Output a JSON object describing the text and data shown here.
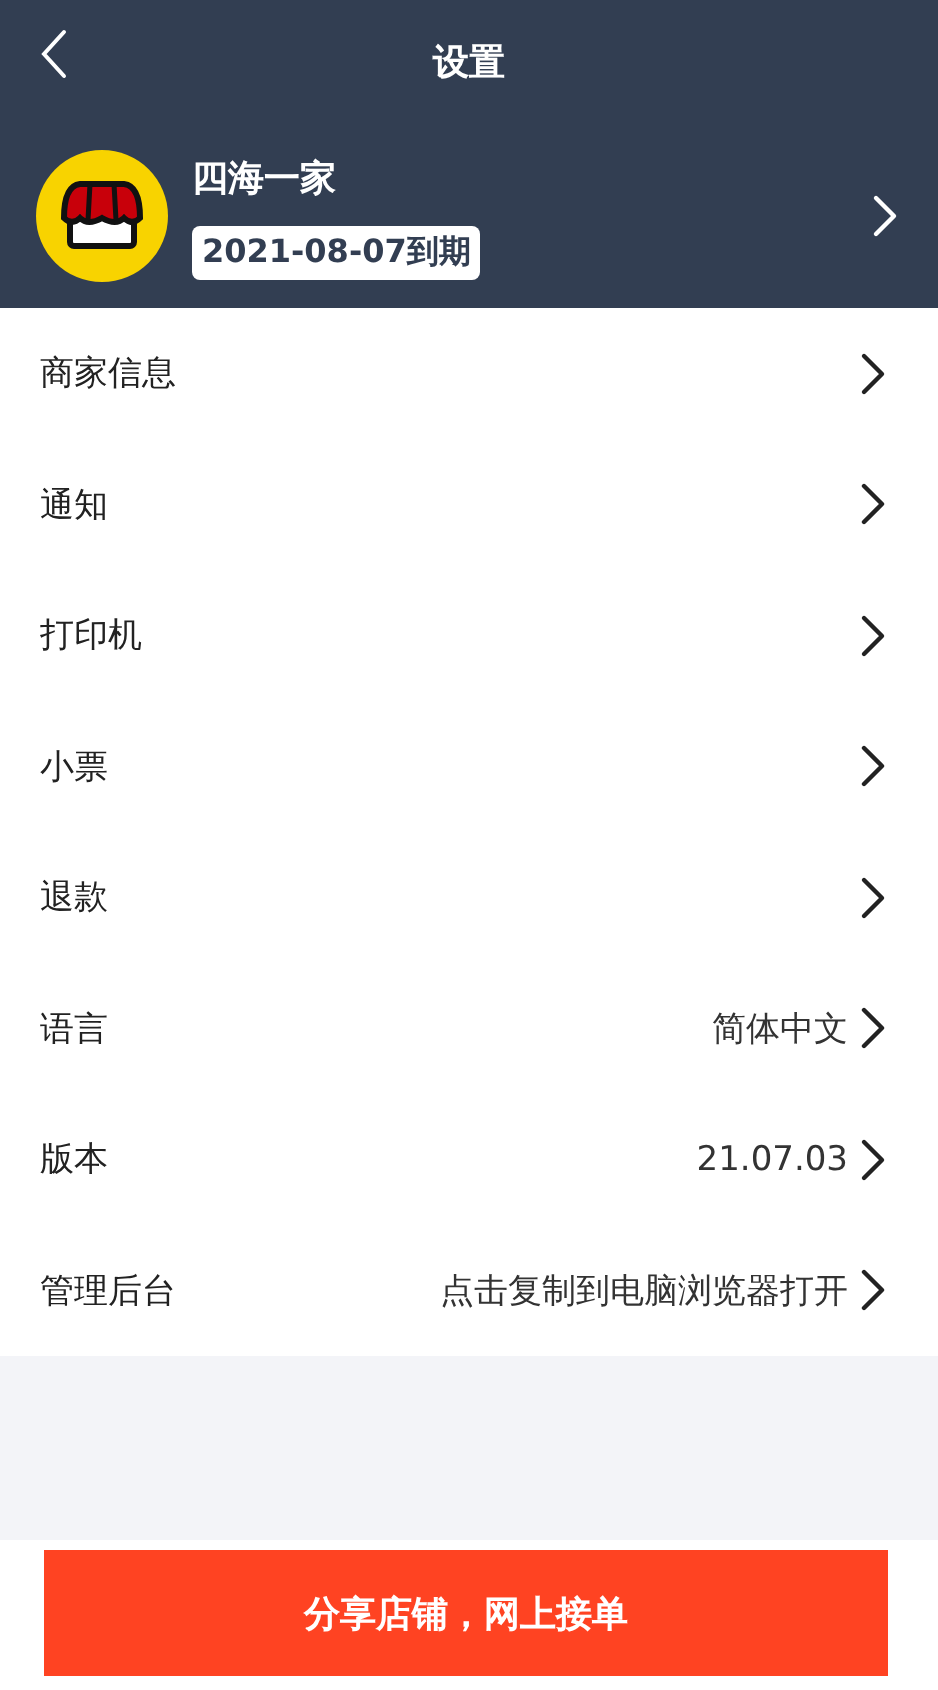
{
  "header": {
    "title": "设置"
  },
  "store": {
    "name": "四海一家",
    "expiry": "2021-08-07到期"
  },
  "settings": [
    {
      "label": "商家信息"
    },
    {
      "label": "通知"
    },
    {
      "label": "打印机"
    },
    {
      "label": "小票"
    },
    {
      "label": "退款"
    },
    {
      "label": "语言",
      "value": "简体中文"
    },
    {
      "label": "版本",
      "value": "21.07.03"
    },
    {
      "label": "管理后台",
      "value": "点击复制到电脑浏览器打开"
    }
  ],
  "share_button": "分享店铺，网上接单"
}
